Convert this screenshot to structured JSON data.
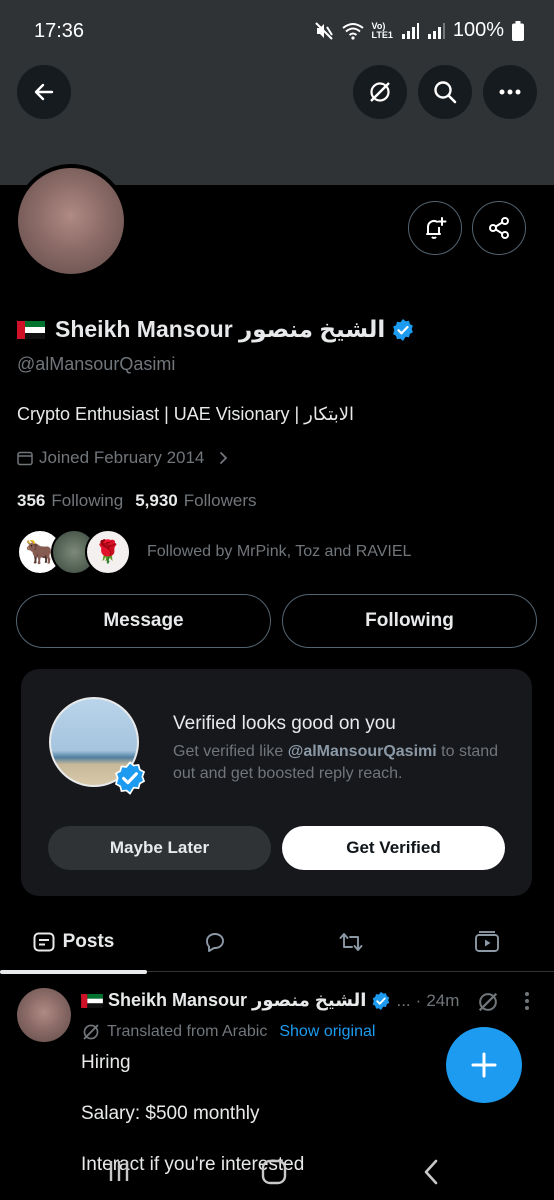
{
  "status_bar": {
    "time": "17:36",
    "volte": "Vo)\nLTE1",
    "battery": "100%"
  },
  "profile": {
    "name": "Sheikh Mansour الشيخ منصور",
    "handle": "@alMansourQasimi",
    "bio": "Crypto Enthusiast | UAE Visionary | الابتكار",
    "joined": "Joined February 2014",
    "following_count": "356",
    "following_label": "Following",
    "followers_count": "5,930",
    "followers_label": "Followers",
    "followed_by": "Followed by MrPink, Toz and RAVIEL"
  },
  "actions": {
    "message": "Message",
    "following": "Following"
  },
  "promo": {
    "title": "Verified looks good on you",
    "sub_prefix": "Get verified like ",
    "sub_handle": "@alMansourQasimi",
    "sub_suffix": " to stand out and get boosted reply reach.",
    "maybe_later": "Maybe Later",
    "get_verified": "Get Verified"
  },
  "tabs": {
    "posts": "Posts",
    "active": "posts"
  },
  "post": {
    "name": "Sheikh Mansour الشيخ منصور",
    "ellipsis": "...",
    "time": "24m",
    "translated": "Translated from Arabic",
    "show_original": "Show original",
    "lines": [
      "Hiring",
      "Salary: $500 monthly",
      "Interact if you're interested"
    ]
  },
  "colors": {
    "accent": "#1d9bf0",
    "background": "#000000",
    "muted": "#71767b",
    "text": "#e7e9ea"
  }
}
